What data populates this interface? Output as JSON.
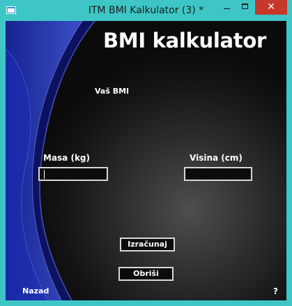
{
  "window": {
    "title": "ITM BMI Kalkulator (3) *",
    "controls": {
      "minimize": "",
      "maximize": "",
      "close": "✕"
    }
  },
  "form": {
    "heading": "BMI kalkulator",
    "result_label": "Vaš BMI",
    "mass_label": "Masa (kg)",
    "mass_value": "",
    "height_label": "Visina (cm)",
    "height_value": "",
    "calculate_button": "Izračunaj",
    "clear_button": "Obriši",
    "back_link": "Nazad",
    "help_link": "?"
  },
  "colors": {
    "titlebar": "#3ec6c6",
    "close_button": "#c7382b",
    "background_dark": "#0b0b0b",
    "swirl_blue": "#2a3fb8",
    "text": "#ffffff"
  }
}
